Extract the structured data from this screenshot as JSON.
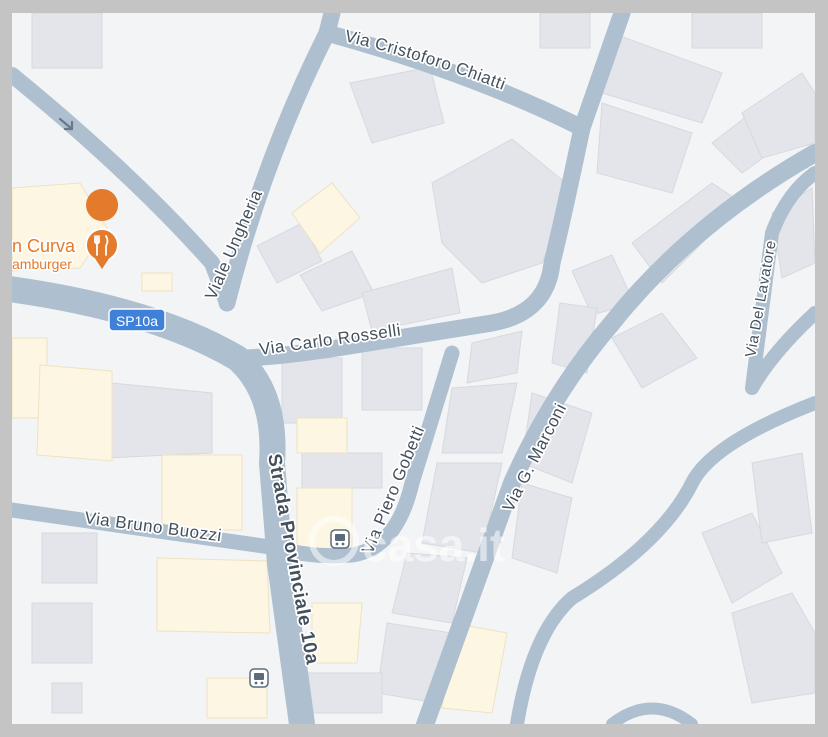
{
  "streets": {
    "cristoforo_chiatti": "Via Cristoforo Chiatti",
    "viale_ungheria": "Viale Ungheria",
    "carlo_rosselli": "Via Carlo Rosselli",
    "piero_gobetti": "Via Piero Gobetti",
    "g_marconi": "Via G. Marconi",
    "del_lavatore": "Via Del Lavatore",
    "bruno_buozzi": "Via Bruno Buozzi",
    "strada_provinciale": "Strada Provinciale 10a"
  },
  "road_badge": "SP10a",
  "poi": {
    "name": "n Curva",
    "category": "amburger",
    "icon": "restaurant-icon",
    "color": "#e37a2c"
  },
  "watermark": "casa.it",
  "colors": {
    "road": "#aebfcf",
    "background": "#f3f4f6",
    "building": "#e3e5ea",
    "highlight_building": "#fdf6e3",
    "badge": "#3f80d8"
  },
  "icons": [
    "restaurant-icon",
    "bus-stop-icon",
    "direction-arrow-icon"
  ]
}
